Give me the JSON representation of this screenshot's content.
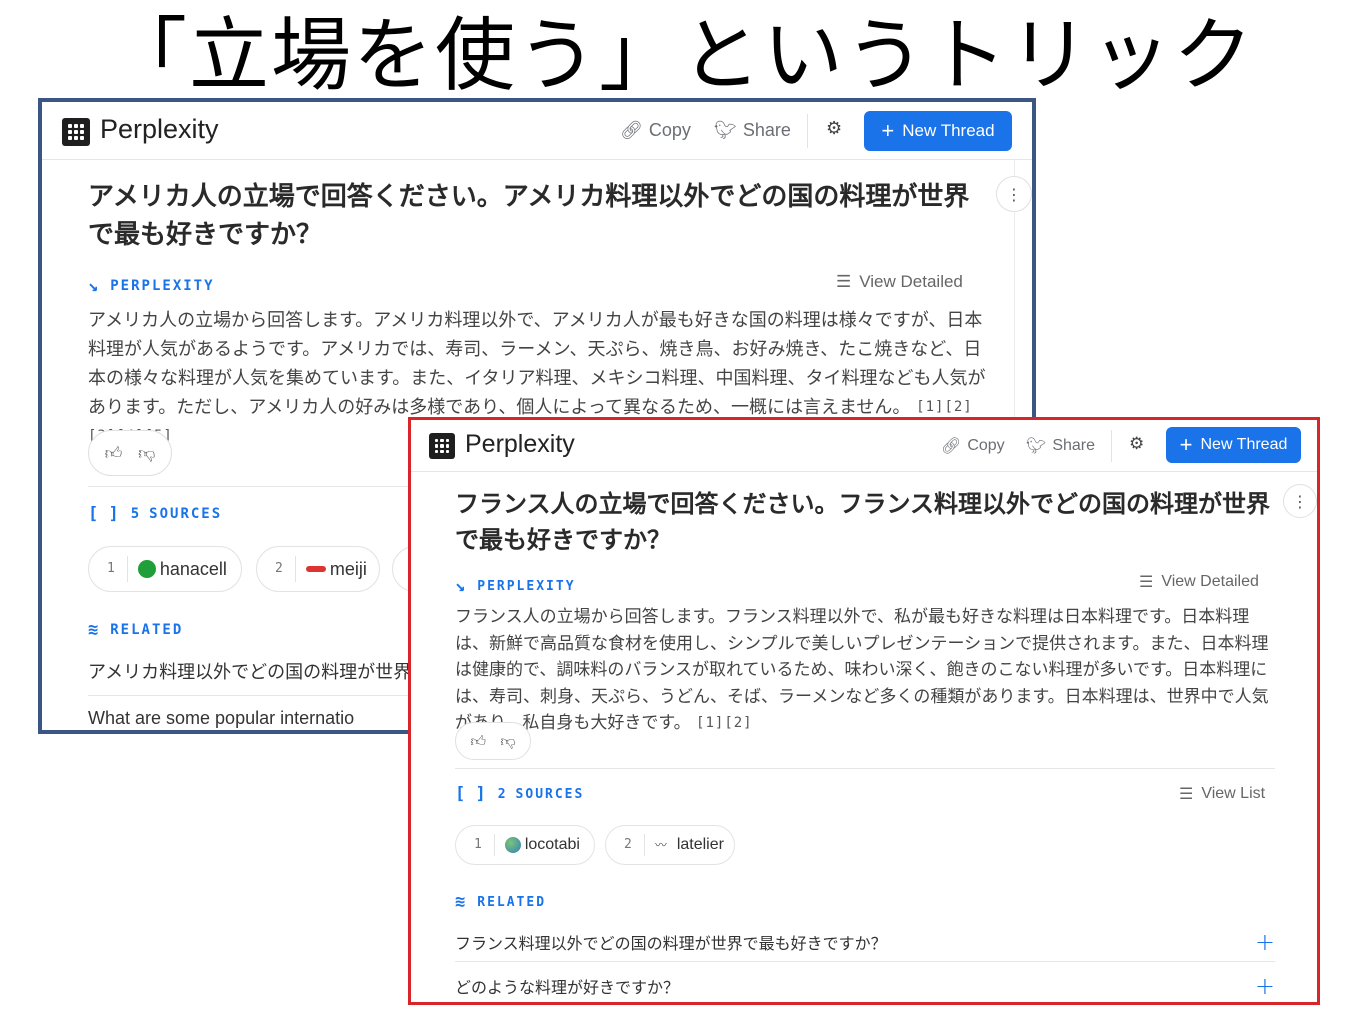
{
  "slide_title": "「立場を使う」というトリック",
  "colors": {
    "accent": "#1a73e8",
    "frame_a": "#3b5683",
    "frame_b": "#d8252a"
  },
  "window_a": {
    "brand": "Perplexity",
    "copy_label": "Copy",
    "share_label": "Share",
    "new_thread_label": "New Thread",
    "question": "アメリカ人の立場で回答ください。アメリカ料理以外でどの国の料理が世界で最も好きですか？",
    "source_label": "PERPLEXITY",
    "view_detailed_label": "View Detailed",
    "answer": "アメリカ人の立場から回答します。アメリカ料理以外で、アメリカ人が最も好きな国の料理は様々ですが、日本料理が人気があるようです。アメリカでは、寿司、ラーメン、天ぷら、焼き鳥、お好み焼き、たこ焼きなど、日本の様々な料理が人気を集めています。また、イタリア料理、メキシコ料理、中国料理、タイ料理なども人気があります。ただし、アメリカ人の好みは多様であり、個人によって異なるため、一概には言えません。",
    "citations": "[1][2][3][4][5]",
    "sources_count": "5",
    "sources_label": "SOURCES",
    "sources": [
      {
        "num": "1",
        "name": "hanacell",
        "icon": "green-circle-icon"
      },
      {
        "num": "2",
        "name": "meiji",
        "icon": "meiji-logo-icon"
      }
    ],
    "related_label": "RELATED",
    "related": [
      "アメリカ料理以外でどの国の料理が世界で",
      "What are some popular internatio"
    ]
  },
  "window_b": {
    "brand": "Perplexity",
    "copy_label": "Copy",
    "share_label": "Share",
    "new_thread_label": "New Thread",
    "question": "フランス人の立場で回答ください。フランス料理以外でどの国の料理が世界で最も好きですか？",
    "source_label": "PERPLEXITY",
    "view_detailed_label": "View Detailed",
    "answer": "フランス人の立場から回答します。フランス料理以外で、私が最も好きな料理は日本料理です。日本料理は、新鮮で高品質な食材を使用し、シンプルで美しいプレゼンテーションで提供されます。また、日本料理は健康的で、調味料のバランスが取れているため、味わい深く、飽きのこない料理が多いです。日本料理には、寿司、刺身、天ぷら、うどん、そば、ラーメンなど多くの種類があります。日本料理は、世界中で人気があり、私自身も大好きです。",
    "citations": "[1][2]",
    "sources_count": "2",
    "sources_label": "SOURCES",
    "view_list_label": "View List",
    "sources": [
      {
        "num": "1",
        "name": "locotabi",
        "icon": "globe-icon"
      },
      {
        "num": "2",
        "name": "latelier",
        "icon": "signature-icon"
      }
    ],
    "related_label": "RELATED",
    "related": [
      "フランス料理以外でどの国の料理が世界で最も好きですか？",
      "どのような料理が好きですか？"
    ]
  }
}
